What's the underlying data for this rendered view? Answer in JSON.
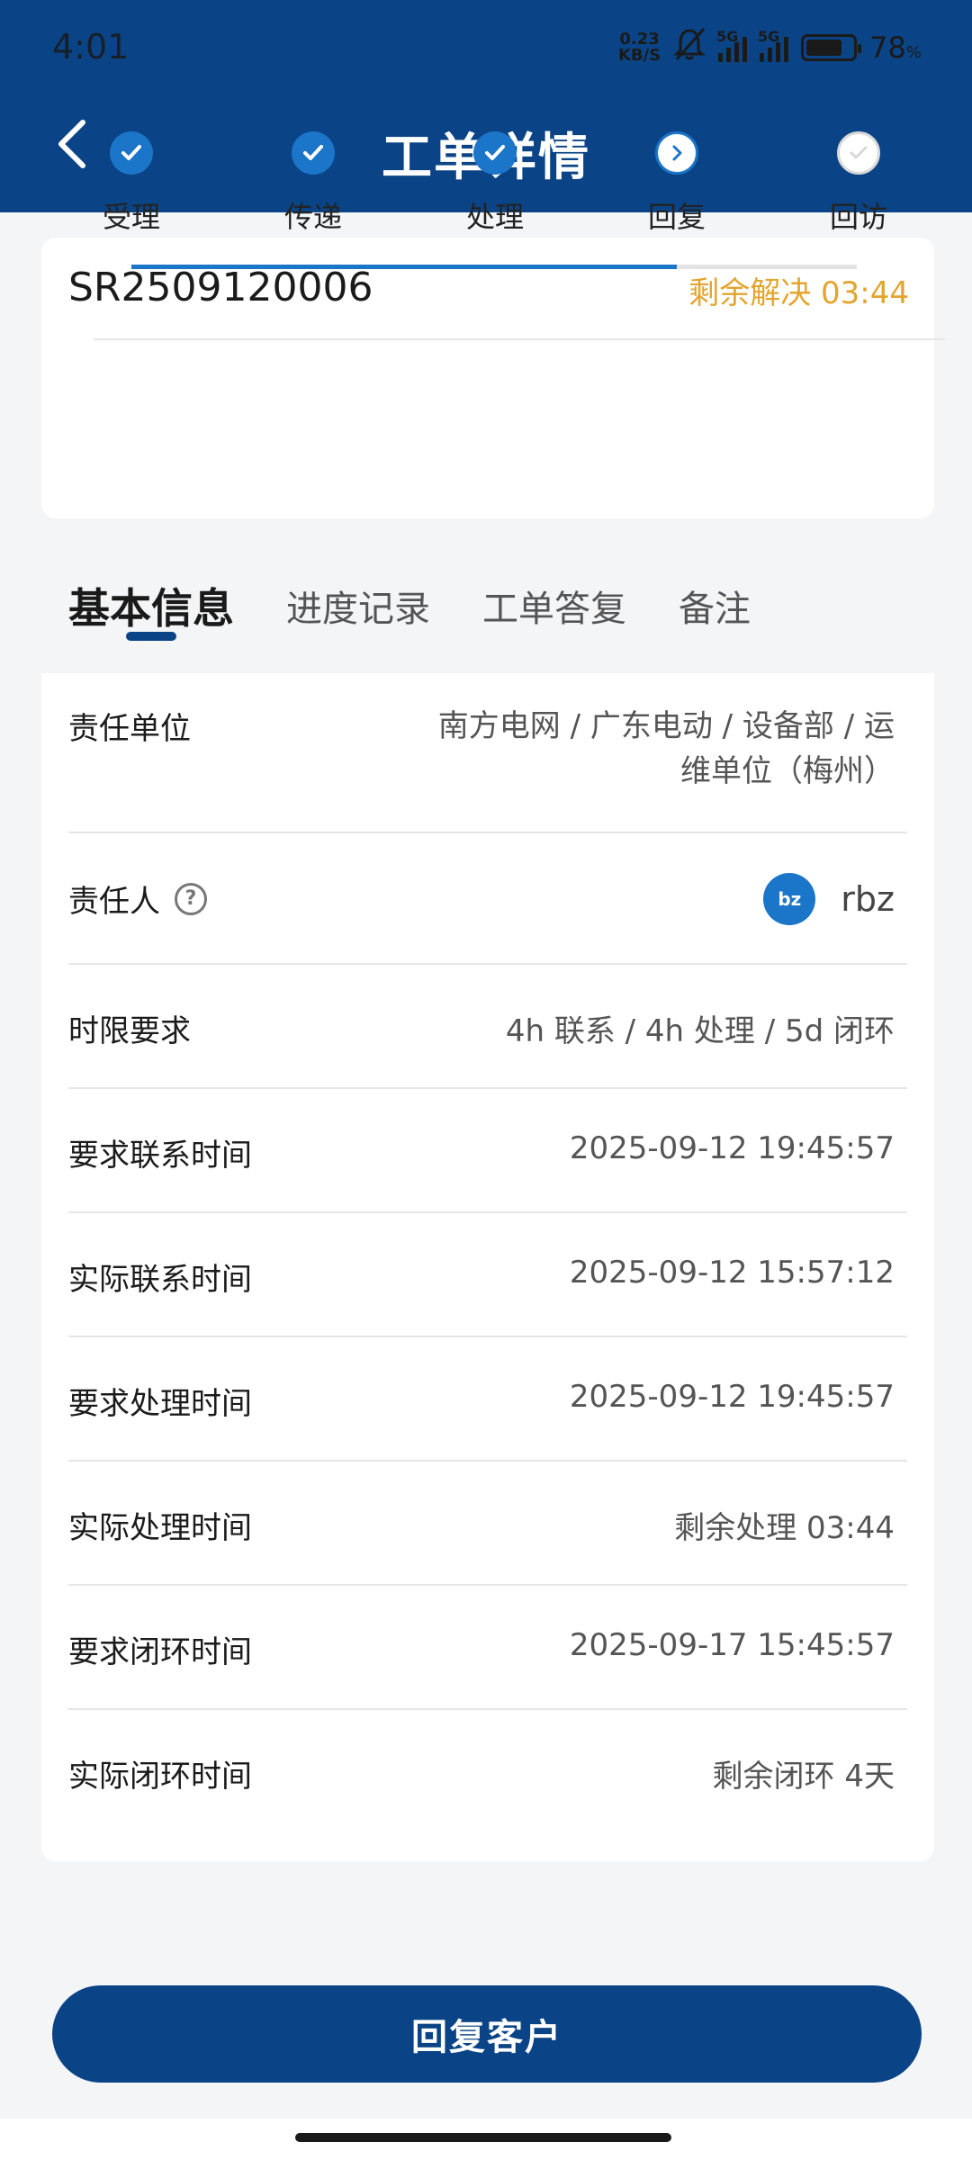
{
  "status_bar": {
    "time": "4:01",
    "net_speed_value": "0.23",
    "net_speed_unit": "KB/S",
    "sim1": "5G",
    "sim2": "5G",
    "battery_percent": "78",
    "battery_unit": "%",
    "battery_level": 0.78
  },
  "header": {
    "title": "工单详情",
    "background_color": "#0a4486"
  },
  "order": {
    "id": "SR2509120006",
    "remaining": "剩余解决 03:44",
    "remaining_color": "#e3a530",
    "steps": [
      {
        "label": "受理",
        "state": "done"
      },
      {
        "label": "传递",
        "state": "done"
      },
      {
        "label": "处理",
        "state": "done"
      },
      {
        "label": "回复",
        "state": "current"
      },
      {
        "label": "回访",
        "state": "todo"
      }
    ]
  },
  "tabs": {
    "items": [
      {
        "label": "基本信息",
        "active": true
      },
      {
        "label": "进度记录",
        "active": false
      },
      {
        "label": "工单答复",
        "active": false
      },
      {
        "label": "备注",
        "active": false
      }
    ]
  },
  "details": {
    "responsible_unit": {
      "label": "责任单位",
      "value_line1": "南方电网 / 广东电动 / 设备部 / 运",
      "value_line2": "维单位（梅州）"
    },
    "responsible_person": {
      "label": "责任人",
      "avatar_text": "bz",
      "name": "rbz"
    },
    "time_limit": {
      "label": "时限要求",
      "value": "4h 联系 / 4h 处理 / 5d 闭环"
    },
    "required_contact_time": {
      "label": "要求联系时间",
      "value": "2025-09-12 19:45:57"
    },
    "actual_contact_time": {
      "label": "实际联系时间",
      "value": "2025-09-12 15:57:12"
    },
    "required_process_time": {
      "label": "要求处理时间",
      "value": "2025-09-12 19:45:57"
    },
    "actual_process_time": {
      "label": "实际处理时间",
      "value": "剩余处理 03:44"
    },
    "required_close_time": {
      "label": "要求闭环时间",
      "value": "2025-09-17 15:45:57"
    },
    "actual_close_time": {
      "label": "实际闭环时间",
      "value": "剩余闭环 4天"
    }
  },
  "actions": {
    "reply_label": "回复客户"
  }
}
